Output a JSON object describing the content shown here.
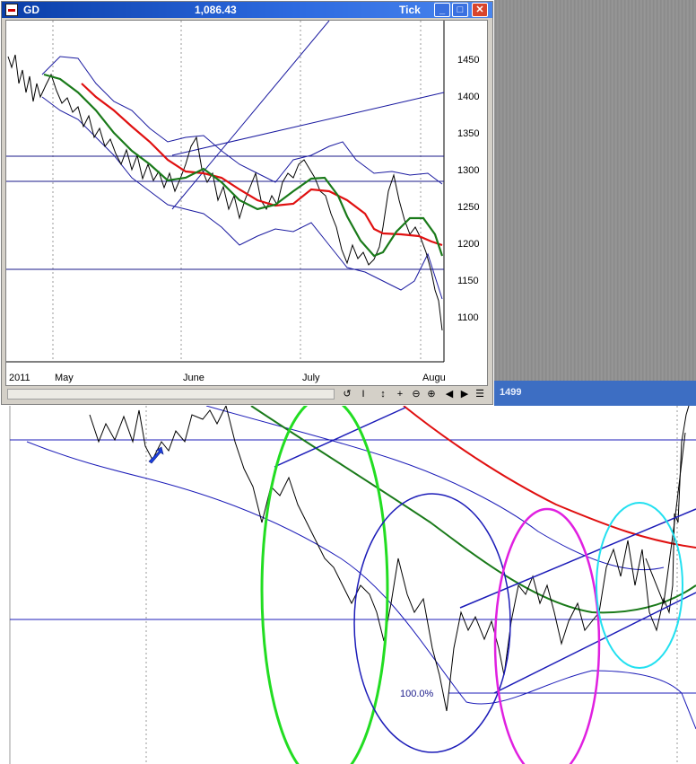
{
  "window": {
    "title": "GD",
    "price": "1,086.43",
    "mode": "Tick",
    "buttons": {
      "minimize": "_",
      "maximize": "□",
      "close": "✕"
    }
  },
  "inset_chart": {
    "y_ticks": [
      "1450",
      "1400",
      "1350",
      "1300",
      "1250",
      "1200",
      "1150",
      "1100"
    ],
    "x_labels": [
      "2011",
      "May",
      "June",
      "July",
      "Augu"
    ]
  },
  "toolbar": {
    "tools": [
      "cycle-icon",
      "cursor-icon",
      "updown-icon",
      "crosshair-icon",
      "zoom-out-icon",
      "zoom-in-icon",
      "prev-icon",
      "next-icon",
      "menu-icon"
    ],
    "glyphs": [
      "↺",
      "I",
      "↕",
      "+",
      "⊖",
      "⊕",
      "◀",
      "▶",
      "☰"
    ]
  },
  "background_window": {
    "label": "1499"
  },
  "annotation": {
    "fib_label": "100.0%"
  },
  "colors": {
    "price": "#000000",
    "ma_fast": "#1a7a1a",
    "ma_slow": "#e01010",
    "bands": "#1a1aa0",
    "green_ellipse": "#22dd22",
    "blue_ellipse": "#1c1cb8",
    "magenta_ellipse": "#e020e0",
    "cyan_ellipse": "#22e0f0"
  }
}
